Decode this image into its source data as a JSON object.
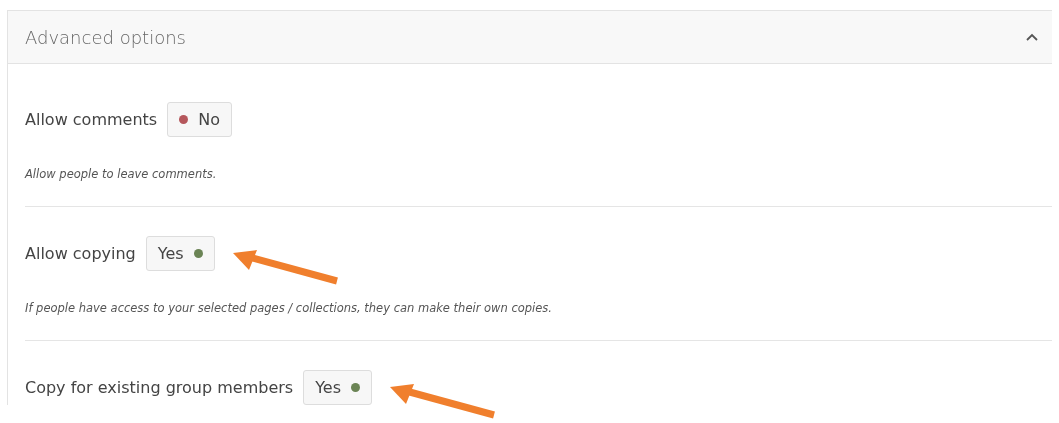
{
  "panel": {
    "title": "Advanced options",
    "expanded": true,
    "options": [
      {
        "label": "Allow comments",
        "value": "No",
        "on": false,
        "highlighted": false,
        "description": "Allow people to leave comments."
      },
      {
        "label": "Allow copying",
        "value": "Yes",
        "on": true,
        "highlighted": true,
        "description": "If people have access to your selected pages / collections, they can make their own copies."
      },
      {
        "label": "Copy for existing group members",
        "value": "Yes",
        "on": true,
        "highlighted": true
      }
    ]
  }
}
